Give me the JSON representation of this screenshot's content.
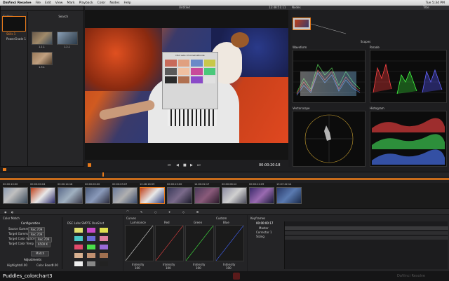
{
  "menubar": {
    "app": "DaVinci Resolve",
    "items": [
      "File",
      "Edit",
      "View",
      "Mark",
      "Playback",
      "Color",
      "Nodes",
      "Help"
    ],
    "clock": "Tue 5:34 PM"
  },
  "gallery": {
    "title": "Gallery",
    "search": "Search",
    "albums": [
      "Stills 1",
      "PowerGrade 1"
    ],
    "stills": [
      "1.1.1",
      "1.2.1",
      "1.3.1"
    ]
  },
  "viewer": {
    "title": "Untitled",
    "timecode_top": "12:48:51:11",
    "timecode": "00:00:20:18",
    "chart_title": "DSC Labs ChromaDuMonde"
  },
  "nodes": {
    "title": "Nodes",
    "tab": "Title",
    "node_label": "01"
  },
  "scopes": {
    "label": "Scopes",
    "waveform": "Waveform",
    "parade": "Parade",
    "vectorscope": "Vectorscope",
    "histogram": "Histogram"
  },
  "timeline": {
    "clips": [
      {
        "tc": "00:00:10:00"
      },
      {
        "tc": "00:00:00:04"
      },
      {
        "tc": "00:00:14:18"
      },
      {
        "tc": "00:00:00:00"
      },
      {
        "tc": "00:00:03:07"
      },
      {
        "tc": "12:48:16:59"
      },
      {
        "tc": "00:00:15:00"
      },
      {
        "tc": "14:00:02:17"
      },
      {
        "tc": "00:00:08:12"
      },
      {
        "tc": "00:00:12:09"
      },
      {
        "tc": "13:07:42:14"
      }
    ]
  },
  "colormatch": {
    "title": "Color Match",
    "config": "Configuration",
    "source_gamma_label": "Source Gamma",
    "source_gamma": "Rec.709",
    "target_gamma_label": "Target Gamma",
    "target_gamma": "Rec.709",
    "target_space_label": "Target Color Space",
    "target_space": "Rec.709",
    "target_temp_label": "Target Color Temp",
    "target_temp": "6500 K",
    "match_button": "Match",
    "adjustments": "Adjustments",
    "highlights_label": "Highlights",
    "highlights": "0.00",
    "color_boost_label": "Color Boost",
    "color_boost": "0.00",
    "chart_name": "DSC Labs SMPTE OneShot"
  },
  "curves": {
    "title": "Curves",
    "channels": [
      "Luminance",
      "Red",
      "Green",
      "Blue"
    ],
    "intensity_label": "Intensity",
    "intensity": "100",
    "custom": "Custom"
  },
  "keyframes": {
    "title": "Keyframes",
    "timecode": "00:00:00:17",
    "track": "Master",
    "items": [
      "Corrector 1",
      "Sizing"
    ]
  },
  "status": {
    "caption": "Puddles_colorchart3",
    "logo": "DaVinci Resolve"
  }
}
